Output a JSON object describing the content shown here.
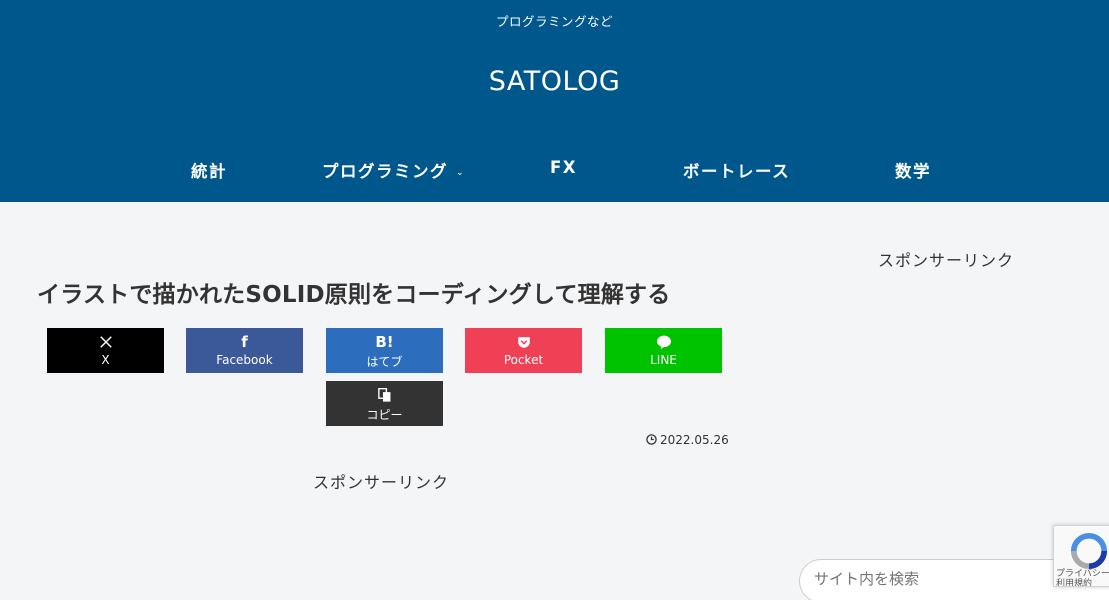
{
  "header": {
    "tagline": "プログラミングなど",
    "site_title": "SATOLOG",
    "nav": [
      {
        "label": "統計"
      },
      {
        "label": "プログラミング"
      },
      {
        "label": "FX"
      },
      {
        "label": "ボートレース"
      },
      {
        "label": "数学"
      }
    ]
  },
  "article": {
    "title": "イラストで描かれたSOLID原則をコーディングして理解する",
    "date": "2022.05.26",
    "share": [
      {
        "label": "X",
        "icon": "x-icon",
        "color": "#000000"
      },
      {
        "label": "Facebook",
        "icon": "facebook-icon",
        "color": "#3b5998"
      },
      {
        "label": "はてブ",
        "icon": "hatena-bookmark-icon",
        "color": "#2c6ebd"
      },
      {
        "label": "Pocket",
        "icon": "pocket-icon",
        "color": "#ef4056"
      },
      {
        "label": "LINE",
        "icon": "line-icon",
        "color": "#00c300"
      },
      {
        "label": "コピー",
        "icon": "copy-icon",
        "color": "#333333"
      }
    ],
    "sponsor_label": "スポンサーリンク"
  },
  "sidebar": {
    "sponsor_label": "スポンサーリンク",
    "search_placeholder": "サイト内を検索"
  },
  "recaptcha": {
    "text_line1": "プライバシー",
    "text_line2": "利用規約"
  },
  "colors": {
    "header_bg": "#00578c",
    "page_bg": "#f4f5f7"
  }
}
